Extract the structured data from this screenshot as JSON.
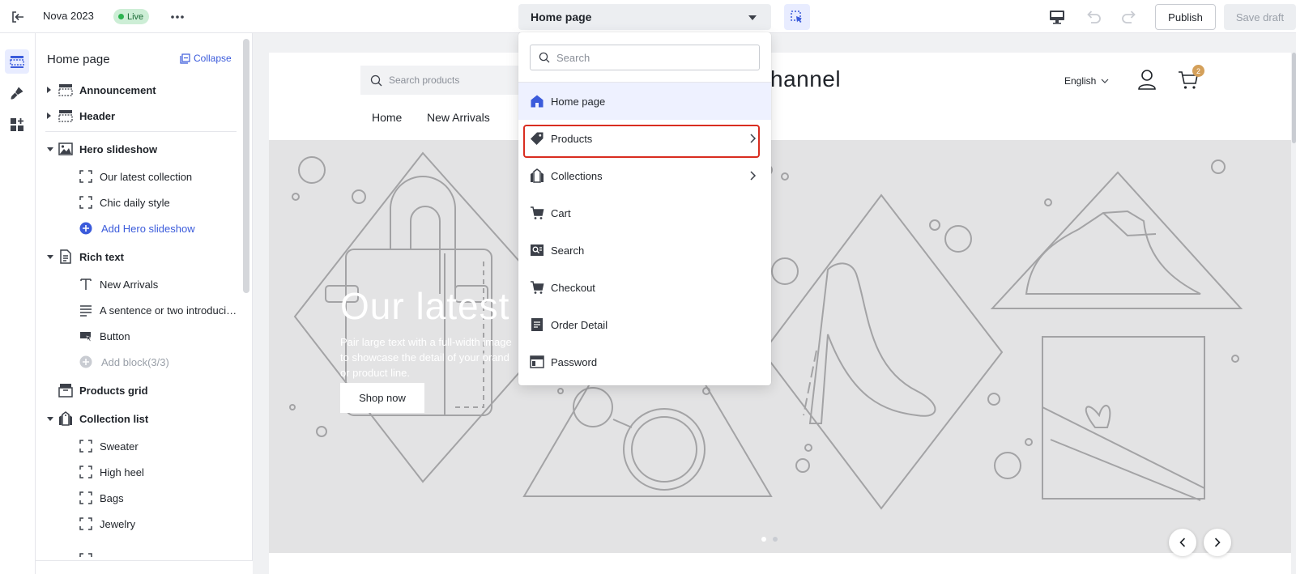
{
  "topbar": {
    "store_name": "Nova 2023",
    "live_label": "Live",
    "page_select_value": "Home page",
    "publish_label": "Publish",
    "save_draft_label": "Save draft"
  },
  "sidebar": {
    "title": "Home page",
    "collapse_label": "Collapse",
    "sections": {
      "announcement": "Announcement",
      "header": "Header",
      "hero_slideshow": "Hero slideshow",
      "hero_child_1": "Our latest collection",
      "hero_child_2": "Chic daily style",
      "hero_add": "Add Hero slideshow",
      "rich_text": "Rich text",
      "rich_child_1": "New Arrivals",
      "rich_child_2": "A sentence or two introducing your brand",
      "rich_child_3": "Button",
      "rich_add": "Add block(3/3)",
      "products_grid": "Products grid",
      "collection_list": "Collection list",
      "coll_child_1": "Sweater",
      "coll_child_2": "High heel",
      "coll_child_3": "Bags",
      "coll_child_4": "Jewelry"
    }
  },
  "store": {
    "search_placeholder": "Search products",
    "logo": "ychannel",
    "language": "English",
    "cart_count": "2",
    "nav": [
      "Home",
      "New Arrivals"
    ],
    "hero_title": "Our latest c",
    "hero_sub": "Pair large text with a full-width image to showcase the detail of your brand or product line.",
    "hero_button": "Shop now"
  },
  "dropdown": {
    "search_placeholder": "Search",
    "items": [
      {
        "label": "Home page",
        "icon": "home-icon"
      },
      {
        "label": "Products",
        "icon": "tag-icon"
      },
      {
        "label": "Collections",
        "icon": "collection-icon"
      },
      {
        "label": "Cart",
        "icon": "cart-icon"
      },
      {
        "label": "Search",
        "icon": "search-page-icon"
      },
      {
        "label": "Checkout",
        "icon": "checkout-icon"
      },
      {
        "label": "Order Detail",
        "icon": "document-icon"
      },
      {
        "label": "Password",
        "icon": "password-page-icon"
      }
    ]
  },
  "colors": {
    "accent": "#3b5bdb",
    "highlight": "#d92d20",
    "live_bg": "#cdeed6"
  }
}
